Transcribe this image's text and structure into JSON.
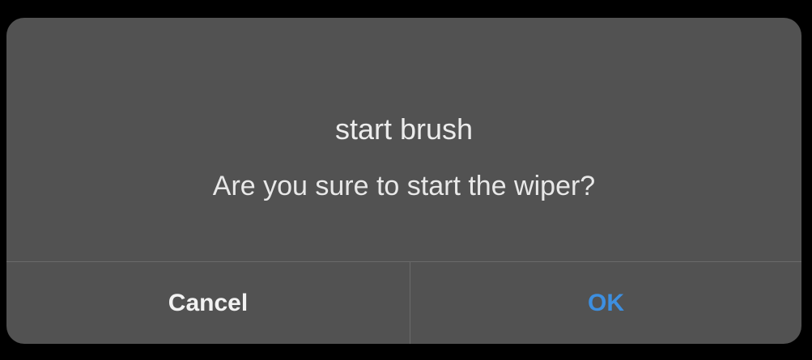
{
  "dialog": {
    "title": "start brush",
    "message": "Are you sure to start the wiper?",
    "cancel_label": "Cancel",
    "ok_label": "OK"
  },
  "colors": {
    "background": "#000000",
    "dialog_bg": "#525252",
    "text": "#ececec",
    "ok_accent": "#3d8fe0",
    "divider": "#6a6a6a"
  }
}
